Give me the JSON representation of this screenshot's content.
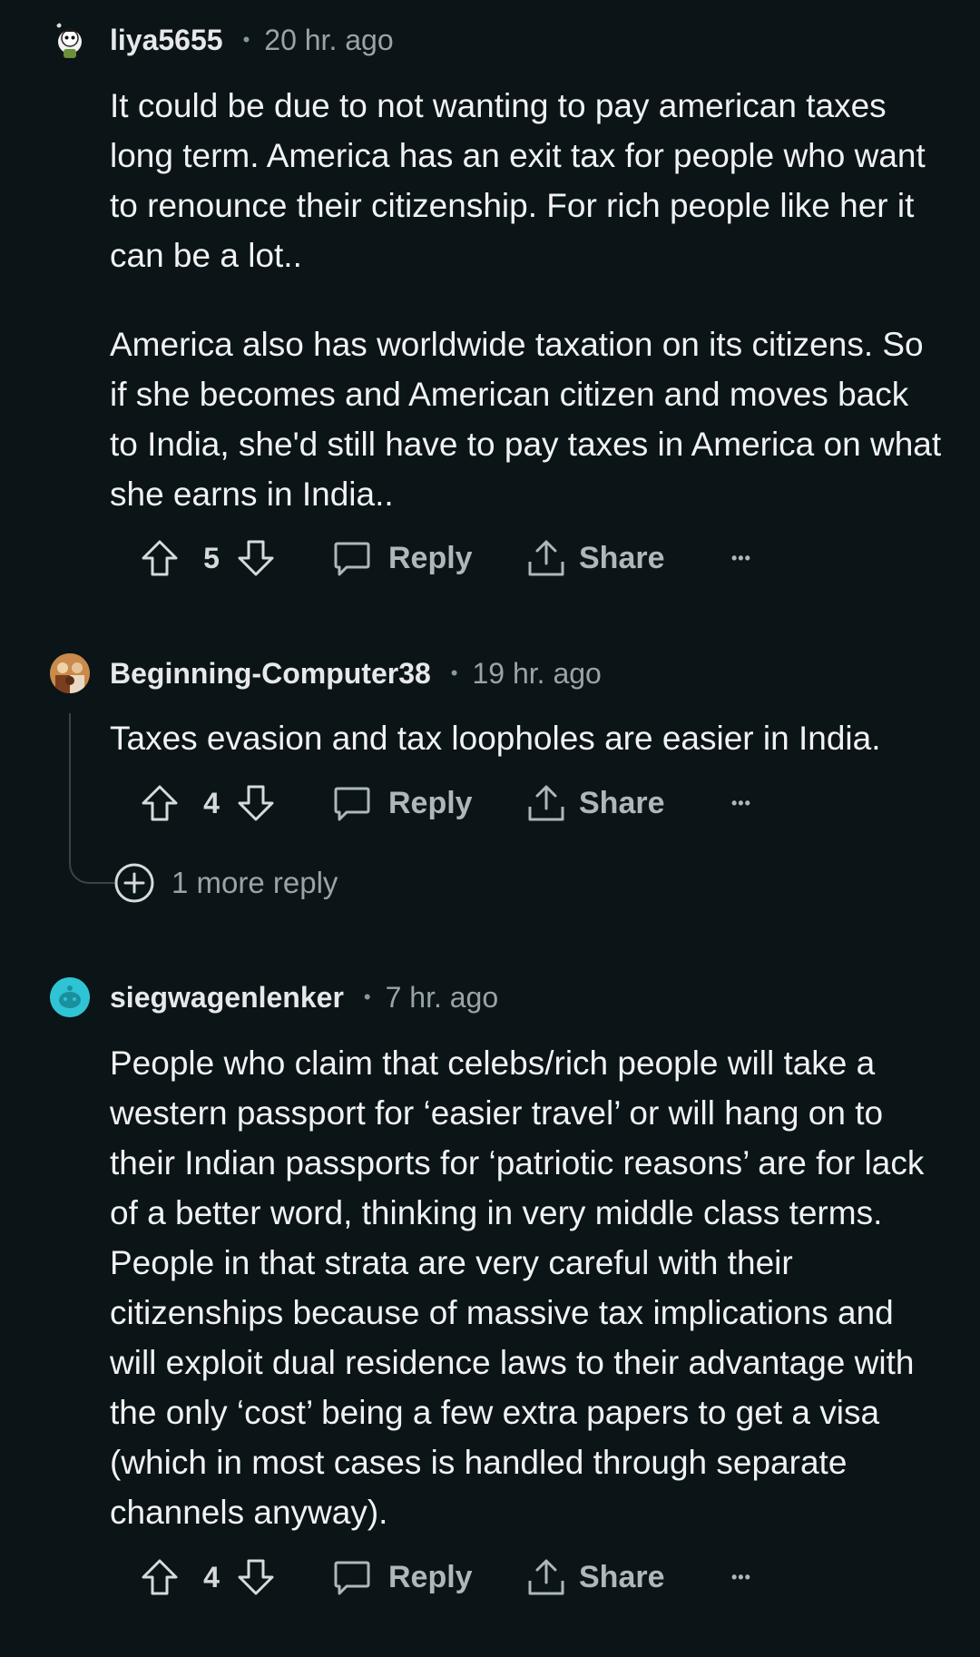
{
  "comments": [
    {
      "username": "liya5655",
      "separator": "•",
      "time": "20 hr. ago",
      "body": [
        "It could be due to not wanting to pay american taxes long term. America has an exit tax for people who want to renounce their citizenship. For rich people like her it can be a lot..",
        "America also has worldwide taxation on its citizens. So if she becomes and American citizen and moves back to India, she'd still have to pay taxes in America on what she earns in India.."
      ],
      "votes": "5",
      "reply_label": "Reply",
      "share_label": "Share",
      "more_label": "•••",
      "avatar_icon": "snoo-avatar-icon"
    },
    {
      "username": "Beginning-Computer38",
      "separator": "•",
      "time": "19 hr. ago",
      "body": [
        "Taxes evasion and tax loopholes are easier in India."
      ],
      "votes": "4",
      "reply_label": "Reply",
      "share_label": "Share",
      "more_label": "•••",
      "more_replies_label": "1 more reply",
      "avatar_icon": "photo-avatar-icon"
    },
    {
      "username": "siegwagenlenker",
      "separator": "•",
      "time": "7 hr. ago",
      "body": [
        "People who claim that celebs/rich people will take a western passport for ‘easier travel’ or will hang on to their Indian passports for ‘patriotic reasons’ are for lack of a better word, thinking in very middle class terms. People in that strata are very careful with their citizenships because of massive tax implications and will exploit dual residence laws to their advantage with the only ‘cost’ being a few extra papers to get a visa (which in most cases is handled through separate channels anyway)."
      ],
      "votes": "4",
      "reply_label": "Reply",
      "share_label": "Share",
      "more_label": "•••",
      "avatar_icon": "default-snoo-avatar-icon"
    }
  ],
  "colors": {
    "background": "#0b1416",
    "text": "#f0f2f3",
    "muted": "#9aa4a8",
    "action": "#aeb8bb",
    "thread_line": "#3a4447",
    "avatar_teal": "#2ec4d6"
  }
}
